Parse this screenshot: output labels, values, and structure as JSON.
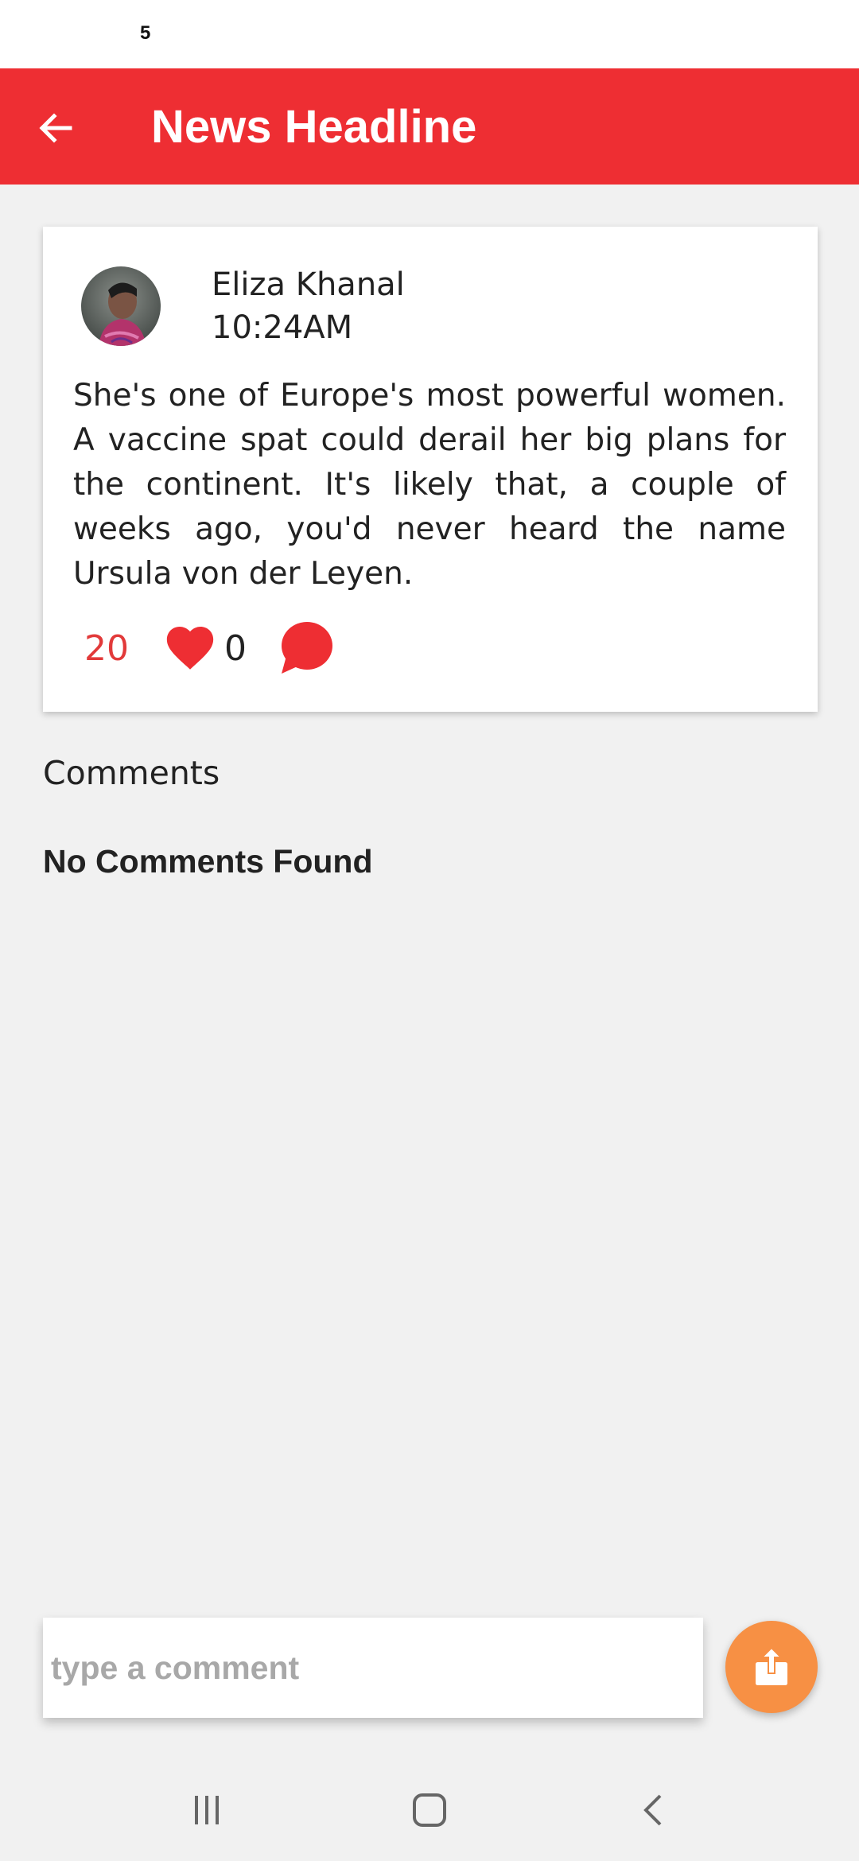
{
  "status_bar": {
    "text": "5"
  },
  "app_bar": {
    "title": "News Headline",
    "color": "#ee2e33"
  },
  "post": {
    "author": "Eliza Khanal",
    "time": "10:24AM",
    "body": "She's one of Europe's most powerful women. A vaccine spat could derail her big plans for the continent. It's likely that, a couple of weeks ago, you'd never heard the name Ursula von der Leyen.",
    "like_count": "20",
    "comment_count": "0",
    "like_icon": "heart-icon",
    "comment_icon": "speech-bubble-icon"
  },
  "comments": {
    "heading": "Comments",
    "empty_message": "No Comments Found"
  },
  "composer": {
    "placeholder": "type a comment",
    "send_icon": "share-upload-icon",
    "send_color": "#f79044"
  },
  "nav_bar": {
    "icons": [
      "recent-apps-icon",
      "home-icon",
      "back-nav-icon"
    ]
  }
}
